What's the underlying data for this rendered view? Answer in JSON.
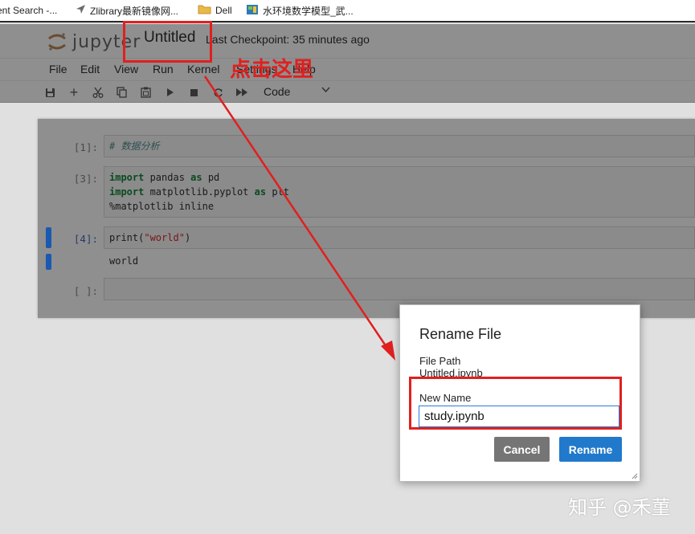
{
  "bookmarks": [
    {
      "label": "ent Search -...",
      "icon": "none"
    },
    {
      "label": "Zlibrary最新镜像网...",
      "icon": "navigation-arrow-icon"
    },
    {
      "label": "Dell",
      "icon": "folder-icon"
    },
    {
      "label": "水环境数学模型_武...",
      "icon": "book-icon"
    }
  ],
  "header": {
    "logo_text": "jupyter",
    "notebook_title": "Untitled",
    "checkpoint": "Last Checkpoint: 35 minutes ago"
  },
  "menu": [
    "File",
    "Edit",
    "View",
    "Run",
    "Kernel",
    "Settings",
    "Help"
  ],
  "toolbar": {
    "icons": [
      "save-icon",
      "add-icon",
      "cut-icon",
      "copy-icon",
      "paste-icon",
      "run-icon",
      "stop-icon",
      "restart-icon",
      "fast-forward-icon"
    ],
    "cell_type": "Code"
  },
  "cells": [
    {
      "prompt": "[1]:",
      "lines": [
        "# 数据分析"
      ]
    },
    {
      "prompt": "[3]:",
      "lines": [
        "import pandas as pd",
        "import matplotlib.pyplot as plt",
        "%matplotlib inline"
      ]
    },
    {
      "prompt": "[4]:",
      "lines": [
        "print(\"world\")"
      ],
      "output": "world"
    },
    {
      "prompt": "[ ]:",
      "lines": [
        ""
      ]
    }
  ],
  "annotation": {
    "text": "点击这里",
    "color": "#e0201f"
  },
  "dialog": {
    "title": "Rename File",
    "path_label": "File Path",
    "path_value": "Untitled.ipynb",
    "name_label": "New Name",
    "name_value": "study.ipynb",
    "cancel_label": "Cancel",
    "rename_label": "Rename"
  },
  "colors": {
    "accent": "#2179cc",
    "cancel": "#757575",
    "annotation": "#e0201f",
    "active_cell": "#1a59b0"
  },
  "watermark": "知乎 @禾菫"
}
